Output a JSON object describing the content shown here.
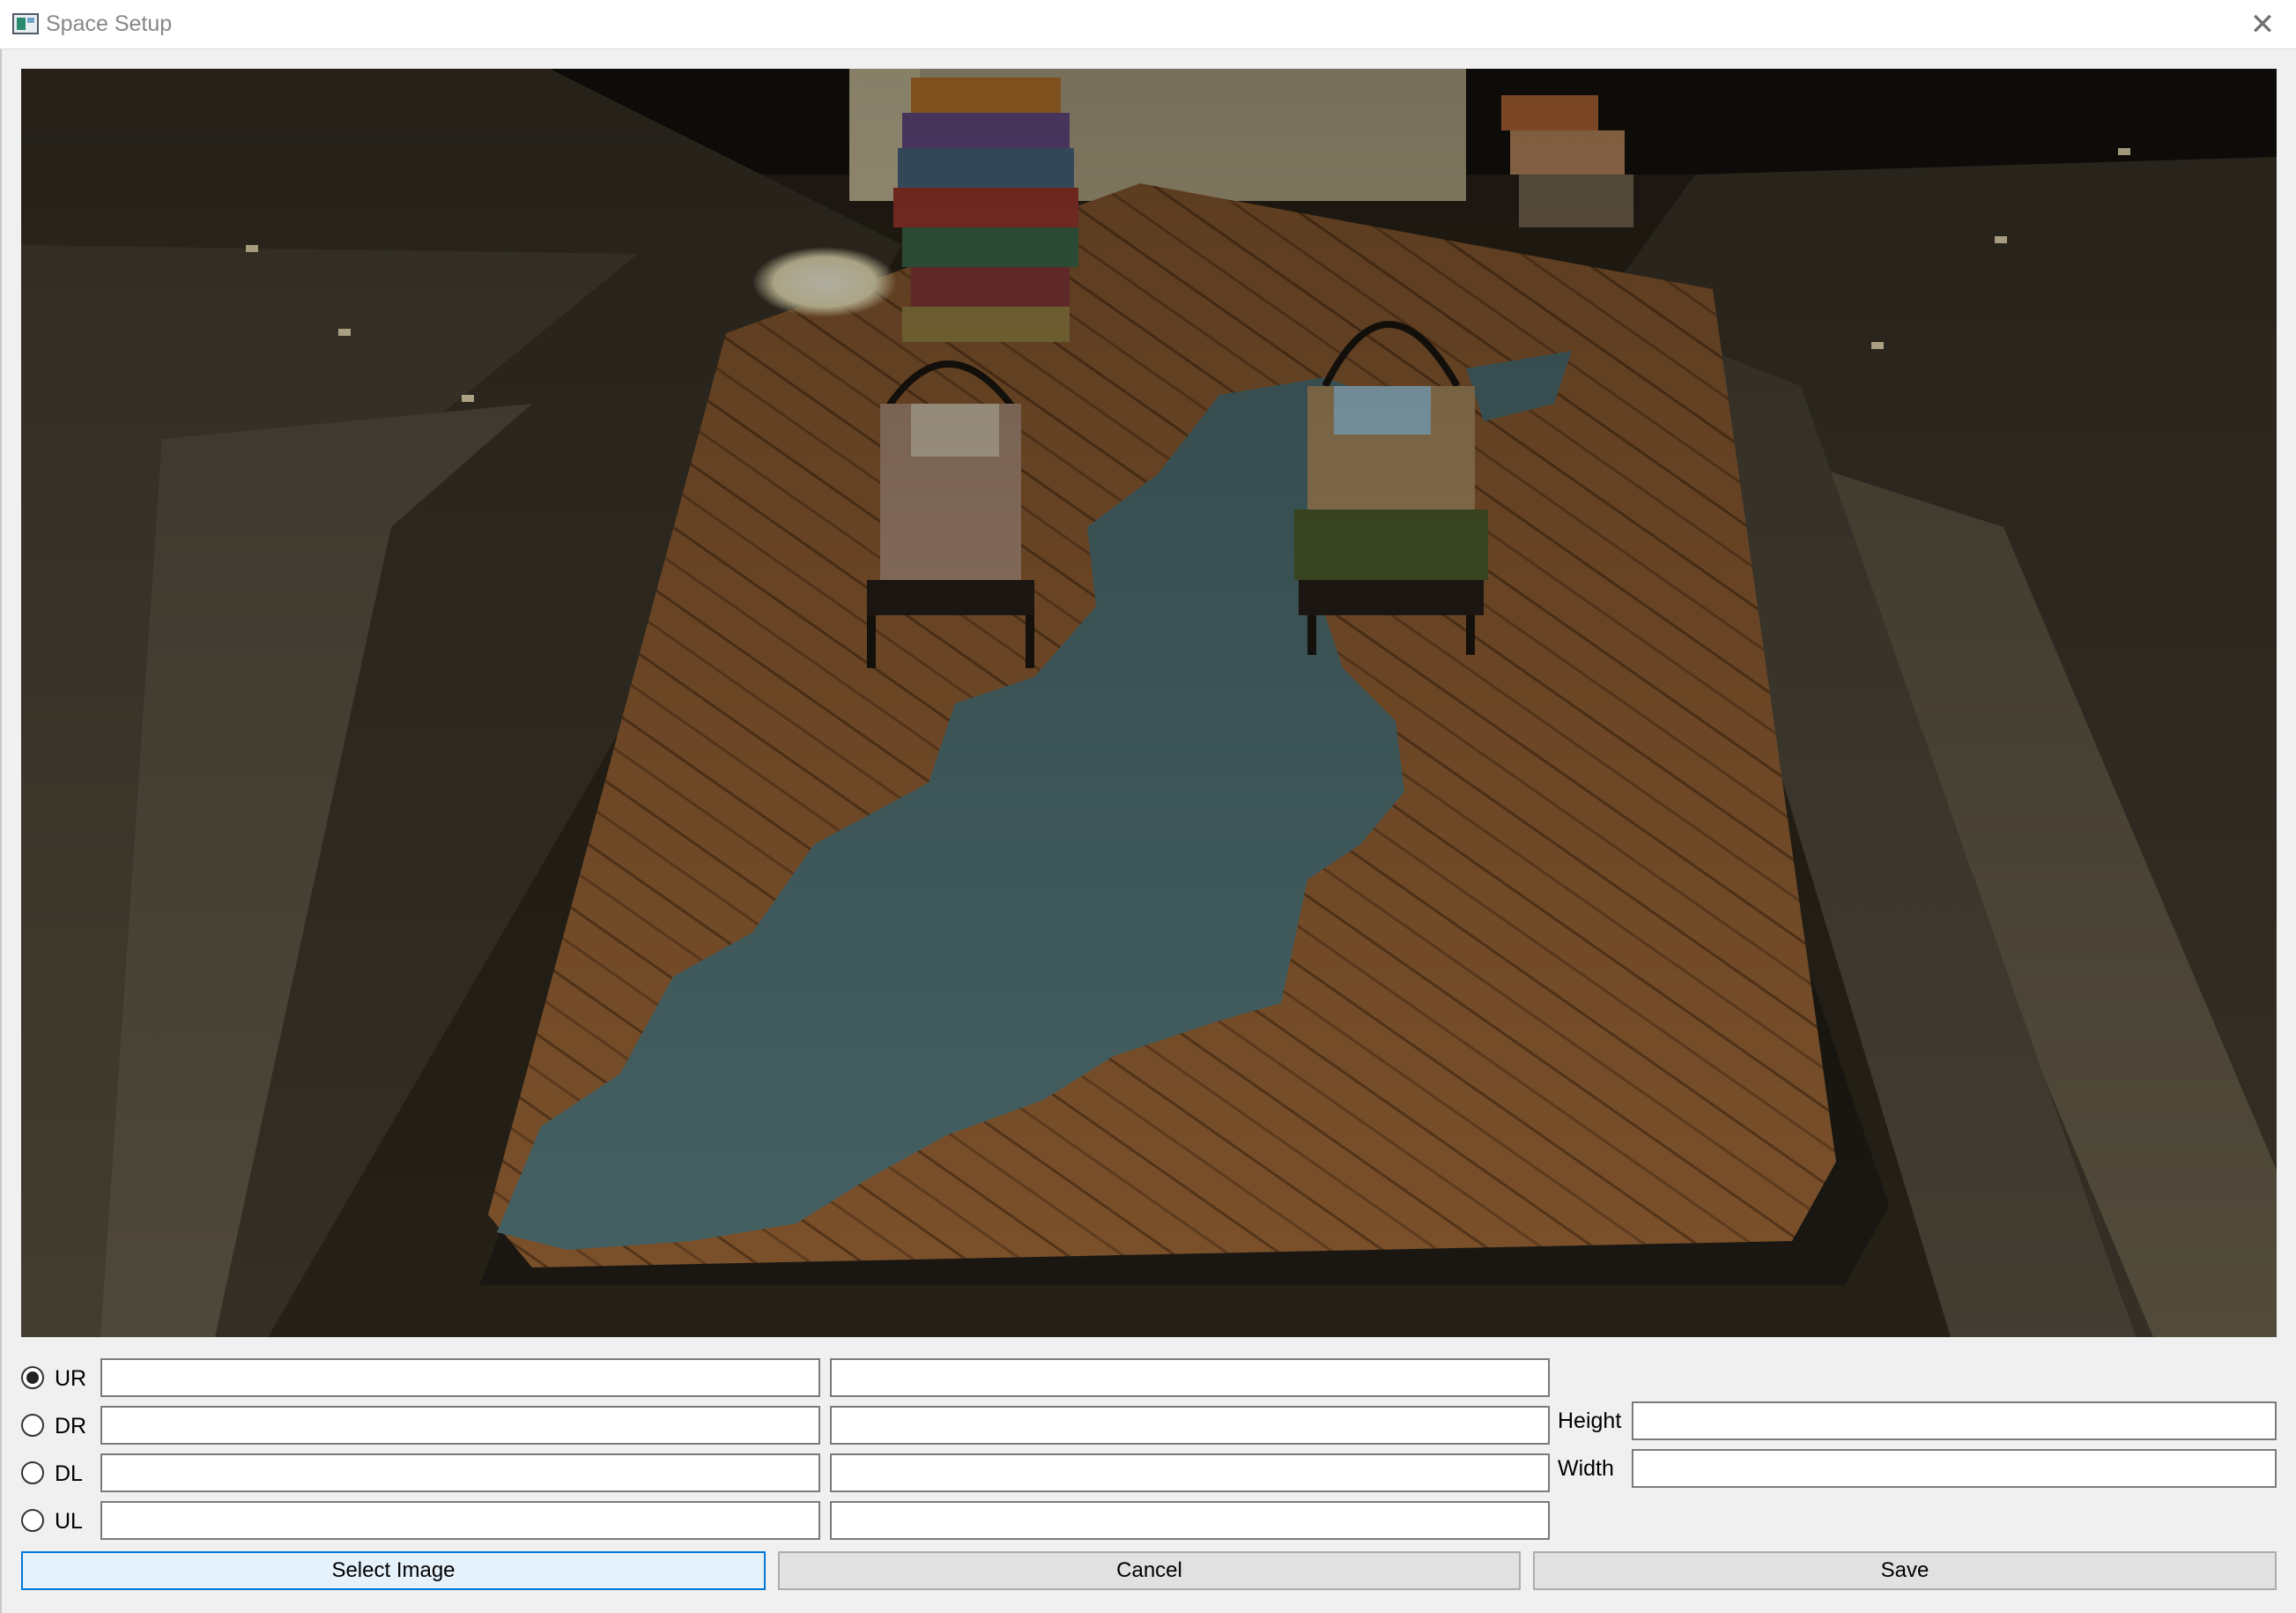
{
  "window": {
    "title": "Space Setup",
    "close_icon": "close-icon"
  },
  "preview": {
    "description_icon": "stage-photo"
  },
  "corners": [
    {
      "label": "UR",
      "selected": true,
      "x_value": "",
      "y_value": ""
    },
    {
      "label": "DR",
      "selected": false,
      "x_value": "",
      "y_value": ""
    },
    {
      "label": "DL",
      "selected": false,
      "x_value": "",
      "y_value": ""
    },
    {
      "label": "UL",
      "selected": false,
      "x_value": "",
      "y_value": ""
    }
  ],
  "dimensions": {
    "height_label": "Height",
    "height_value": "",
    "width_label": "Width",
    "width_value": ""
  },
  "buttons": {
    "select_image": "Select Image",
    "cancel": "Cancel",
    "save": "Save"
  },
  "colors": {
    "focus_border": "#0078d7",
    "button_bg": "#e1e1e1"
  }
}
